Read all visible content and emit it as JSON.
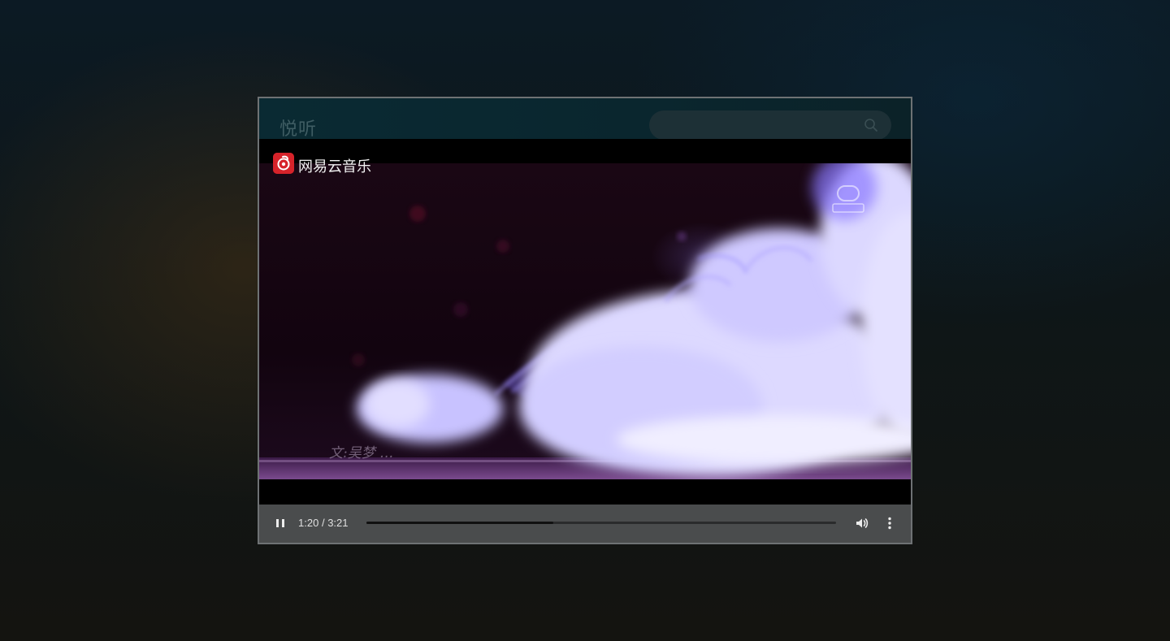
{
  "app": {
    "title": "悦听"
  },
  "search": {
    "value": "",
    "placeholder": "",
    "icon": "search-icon"
  },
  "video": {
    "brand": "网易云音乐",
    "brand_icon": "netease-cloud-music-icon",
    "lyric_overlay": "文:吴梦 …",
    "colors": {
      "brand_red": "#d6232a",
      "smoke": "#c9c2ff"
    }
  },
  "player": {
    "state_icon": "pause-icon",
    "current_time": "1:20",
    "separator": "/",
    "duration": "3:21",
    "progress": 0.398,
    "volume_icon": "volume-icon",
    "more_icon": "more-vertical-icon"
  }
}
